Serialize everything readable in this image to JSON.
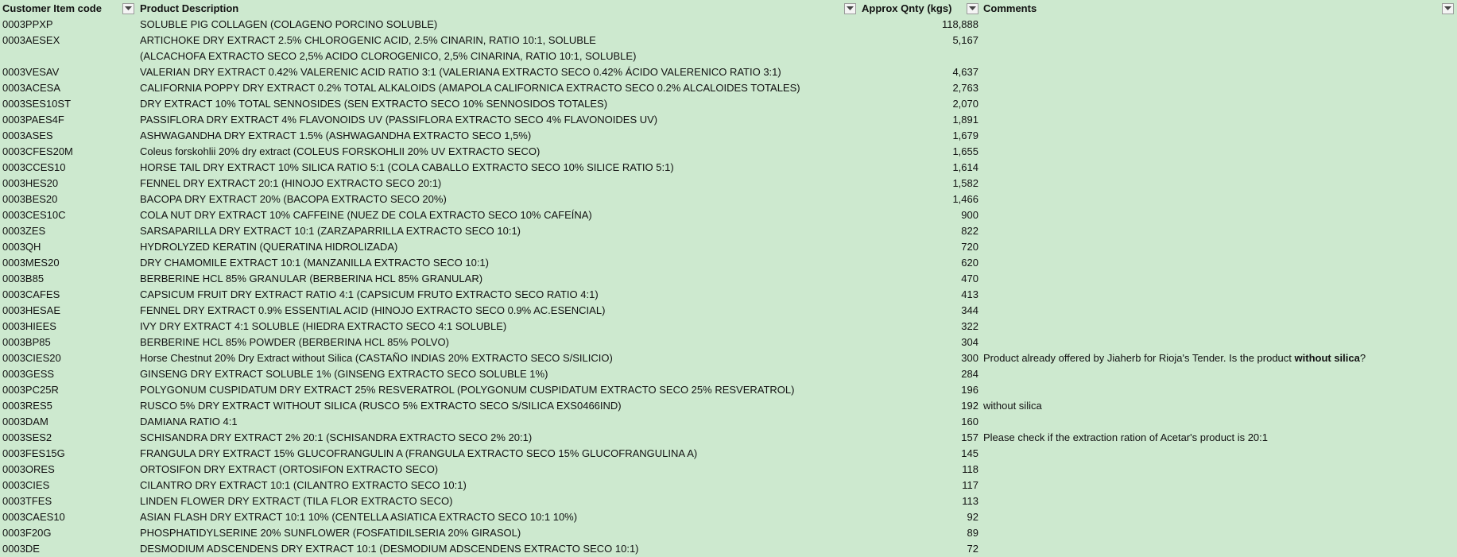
{
  "headers": {
    "code": "Customer Item code",
    "desc": "Product Description",
    "qty": "Approx Qnty (kgs)",
    "comments": "Comments"
  },
  "filter_icon": "dropdown-arrow",
  "colors": {
    "background": "#cde9cf"
  },
  "rows": [
    {
      "code": "0003PPXP",
      "desc": "SOLUBLE PIG COLLAGEN (COLAGENO PORCINO SOLUBLE)",
      "qty": "118,888",
      "comment": ""
    },
    {
      "code": "0003AESEX",
      "desc": "ARTICHOKE DRY EXTRACT 2.5% CHLOROGENIC ACID, 2.5% CINARIN, RATIO 10:1, SOLUBLE",
      "qty": "5,167",
      "comment": ""
    },
    {
      "code": "",
      "desc": "(ALCACHOFA EXTRACTO SECO 2,5% ACIDO CLOROGENICO, 2,5% CINARINA, RATIO 10:1, SOLUBLE)",
      "qty": "",
      "comment": ""
    },
    {
      "code": "0003VESAV",
      "desc": "VALERIAN DRY EXTRACT 0.42% VALERENIC ACID RATIO 3:1 (VALERIANA EXTRACTO SECO 0.42% ÁCIDO VALERENICO RATIO 3:1)",
      "qty": "4,637",
      "comment": ""
    },
    {
      "code": "0003ACESA",
      "desc": "CALIFORNIA POPPY DRY EXTRACT 0.2% TOTAL ALKALOIDS (AMAPOLA CALIFORNICA EXTRACTO SECO 0.2% ALCALOIDES TOTALES)",
      "qty": "2,763",
      "comment": ""
    },
    {
      "code": "0003SES10ST",
      "desc": "DRY EXTRACT 10% TOTAL SENNOSIDES (SEN EXTRACTO SECO 10% SENNOSIDOS TOTALES)",
      "qty": "2,070",
      "comment": ""
    },
    {
      "code": "0003PAES4F",
      "desc": "PASSIFLORA DRY EXTRACT 4% FLAVONOIDS UV (PASSIFLORA EXTRACTO SECO 4% FLAVONOIDES UV)",
      "qty": "1,891",
      "comment": ""
    },
    {
      "code": "0003ASES",
      "desc": "ASHWAGANDHA DRY EXTRACT 1.5% (ASHWAGANDHA EXTRACTO SECO 1,5%)",
      "qty": "1,679",
      "comment": ""
    },
    {
      "code": "0003CFES20M",
      "desc": "Coleus forskohlii 20% dry extract (COLEUS FORSKOHLII 20% UV EXTRACTO SECO)",
      "qty": "1,655",
      "comment": ""
    },
    {
      "code": "0003CCES10",
      "desc": "HORSE TAIL DRY EXTRACT 10% SILICA RATIO 5:1 (COLA CABALLO EXTRACTO SECO 10% SILICE RATIO 5:1)",
      "qty": "1,614",
      "comment": ""
    },
    {
      "code": "0003HES20",
      "desc": "FENNEL DRY EXTRACT 20:1 (HINOJO EXTRACTO SECO 20:1)",
      "qty": "1,582",
      "comment": ""
    },
    {
      "code": "0003BES20",
      "desc": "BACOPA DRY EXTRACT 20% (BACOPA EXTRACTO SECO 20%)",
      "qty": "1,466",
      "comment": ""
    },
    {
      "code": "0003CES10C",
      "desc": "COLA NUT DRY EXTRACT 10% CAFFEINE (NUEZ DE COLA EXTRACTO SECO 10% CAFEÍNA)",
      "qty": "900",
      "comment": ""
    },
    {
      "code": "0003ZES",
      "desc": "SARSAPARILLA DRY EXTRACT 10:1 (ZARZAPARRILLA EXTRACTO SECO 10:1)",
      "qty": "822",
      "comment": ""
    },
    {
      "code": "0003QH",
      "desc": "HYDROLYZED KERATIN (QUERATINA HIDROLIZADA)",
      "qty": "720",
      "comment": ""
    },
    {
      "code": "0003MES20",
      "desc": "DRY CHAMOMILE EXTRACT 10:1 (MANZANILLA EXTRACTO SECO 10:1)",
      "qty": "620",
      "comment": ""
    },
    {
      "code": "0003B85",
      "desc": "BERBERINE HCL 85% GRANULAR (BERBERINA HCL 85% GRANULAR)",
      "qty": "470",
      "comment": ""
    },
    {
      "code": "0003CAFES",
      "desc": "CAPSICUM FRUIT DRY EXTRACT RATIO 4:1 (CAPSICUM FRUTO EXTRACTO SECO RATIO 4:1)",
      "qty": "413",
      "comment": ""
    },
    {
      "code": "0003HESAE",
      "desc": "FENNEL DRY EXTRACT 0.9% ESSENTIAL ACID (HINOJO EXTRACTO SECO 0.9% AC.ESENCIAL)",
      "qty": "344",
      "comment": ""
    },
    {
      "code": "0003HIEES",
      "desc": "IVY DRY EXTRACT 4:1 SOLUBLE (HIEDRA EXTRACTO SECO 4:1 SOLUBLE)",
      "qty": "322",
      "comment": ""
    },
    {
      "code": "0003BP85",
      "desc": "BERBERINE HCL 85% POWDER (BERBERINA HCL 85% POLVO)",
      "qty": "304",
      "comment": ""
    },
    {
      "code": "0003CIES20",
      "desc": "Horse Chestnut 20% Dry Extract without Silica (CASTAÑO INDIAS 20% EXTRACTO SECO S/SILICIO)",
      "qty": "300",
      "comment": "Product already offered by Jiaherb for Rioja's Tender. Is the product ",
      "comment_bold": "without silica",
      "comment_tail": "?"
    },
    {
      "code": "0003GESS",
      "desc": "GINSENG DRY EXTRACT SOLUBLE 1% (GINSENG EXTRACTO SECO SOLUBLE 1%)",
      "qty": "284",
      "comment": ""
    },
    {
      "code": "0003PC25R",
      "desc": "POLYGONUM CUSPIDATUM DRY EXTRACT 25% RESVERATROL (POLYGONUM CUSPIDATUM EXTRACTO SECO 25% RESVERATROL)",
      "qty": "196",
      "comment": ""
    },
    {
      "code": "0003RES5",
      "desc": "RUSCO 5% DRY EXTRACT WITHOUT SILICA (RUSCO 5% EXTRACTO SECO S/SILICA EXS0466IND)",
      "qty": "192",
      "comment": "without silica"
    },
    {
      "code": "0003DAM",
      "desc": "DAMIANA RATIO 4:1",
      "qty": "160",
      "comment": ""
    },
    {
      "code": "0003SES2",
      "desc": "SCHISANDRA DRY EXTRACT 2% 20:1 (SCHISANDRA EXTRACTO SECO 2% 20:1)",
      "qty": "157",
      "comment": "Please check if the extraction ration of Acetar's product is 20:1"
    },
    {
      "code": "0003FES15G",
      "desc": "FRANGULA DRY EXTRACT 15% GLUCOFRANGULIN A (FRANGULA EXTRACTO SECO 15% GLUCOFRANGULINA A)",
      "qty": "145",
      "comment": ""
    },
    {
      "code": "0003ORES",
      "desc": "ORTOSIFON DRY EXTRACT (ORTOSIFON EXTRACTO SECO)",
      "qty": "118",
      "comment": ""
    },
    {
      "code": "0003CIES",
      "desc": "CILANTRO DRY EXTRACT 10:1 (CILANTRO EXTRACTO SECO 10:1)",
      "qty": "117",
      "comment": ""
    },
    {
      "code": "0003TFES",
      "desc": "LINDEN FLOWER DRY EXTRACT (TILA FLOR EXTRACTO SECO)",
      "qty": "113",
      "comment": ""
    },
    {
      "code": "0003CAES10",
      "desc": "ASIAN FLASH DRY EXTRACT 10:1 10% (CENTELLA ASIATICA EXTRACTO SECO 10:1 10%)",
      "qty": "92",
      "comment": ""
    },
    {
      "code": "0003F20G",
      "desc": "PHOSPHATIDYLSERINE 20% SUNFLOWER (FOSFATIDILSERIA 20% GIRASOL)",
      "qty": "89",
      "comment": ""
    },
    {
      "code": "0003DE",
      "desc": "DESMODIUM ADSCENDENS DRY EXTRACT 10:1 (DESMODIUM ADSCENDENS EXTRACTO SECO 10:1)",
      "qty": "72",
      "comment": ""
    }
  ]
}
